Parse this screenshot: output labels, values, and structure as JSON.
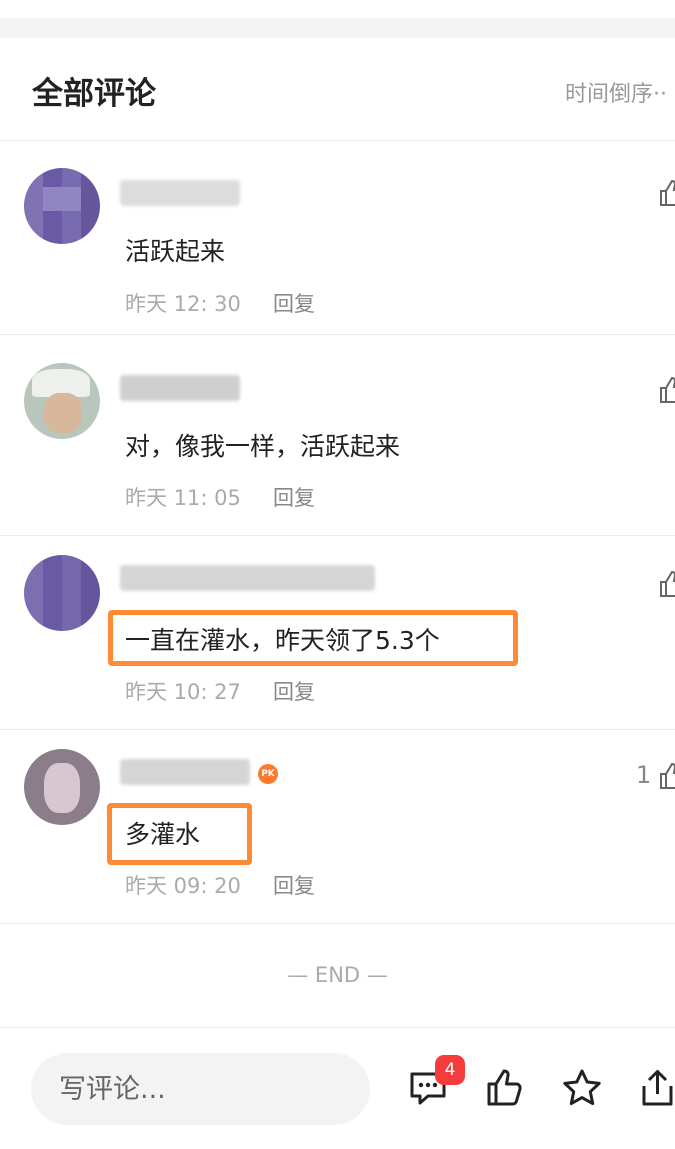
{
  "header": {
    "title": "全部评论",
    "sort_label": "时间倒序··"
  },
  "comments": [
    {
      "text": "活跃起来",
      "time": "昨天 12: 30",
      "reply": "回复",
      "likes": ""
    },
    {
      "text": "对，像我一样，活跃起来",
      "time": "昨天 11: 05",
      "reply": "回复",
      "likes": ""
    },
    {
      "text": "一直在灌水，昨天领了5.3个",
      "time": "昨天 10: 27",
      "reply": "回复",
      "likes": ""
    },
    {
      "text": "多灌水",
      "time": "昨天 09: 20",
      "reply": "回复",
      "likes": "1",
      "badge": "PK"
    }
  ],
  "footer": {
    "end_label": "— END —"
  },
  "bottom_bar": {
    "input_placeholder": "写评论...",
    "comment_badge_count": "4"
  },
  "colors": {
    "highlight": "#ff8a34",
    "badge": "#f53b3b",
    "avatar_purple": "#6a5aa6"
  }
}
